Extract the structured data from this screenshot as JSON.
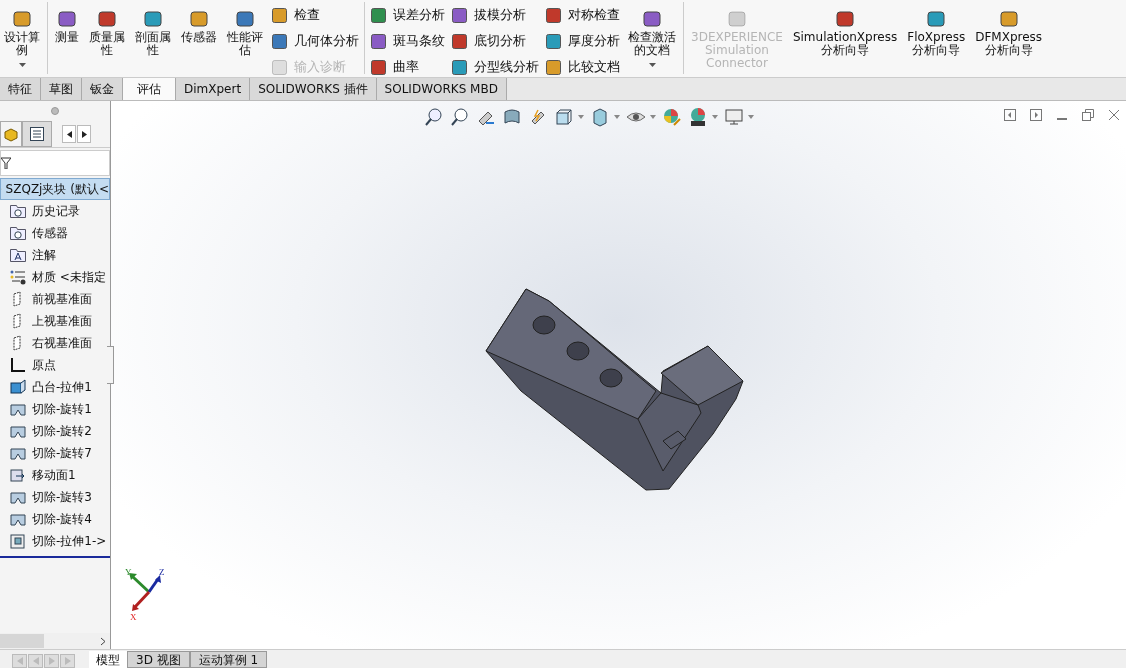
{
  "ribbon": {
    "groups": [
      {
        "sections": [
          {
            "kind": "large",
            "label": "设计算例",
            "menu": true,
            "disabled": false
          }
        ]
      },
      {
        "sections": [
          {
            "kind": "large",
            "label": "测量",
            "menu": false,
            "disabled": false
          },
          {
            "kind": "large",
            "label": "质量属性",
            "menu": false,
            "disabled": false
          },
          {
            "kind": "large",
            "label": "剖面属性",
            "menu": false,
            "disabled": false
          },
          {
            "kind": "large",
            "label": "传感器",
            "menu": false,
            "disabled": false
          },
          {
            "kind": "large",
            "label": "性能评估",
            "menu": false,
            "disabled": false
          },
          {
            "kind": "stack",
            "items": [
              {
                "label": "检查",
                "disabled": false
              },
              {
                "label": "几何体分析",
                "disabled": false
              },
              {
                "label": "输入诊断",
                "disabled": true
              }
            ]
          }
        ]
      },
      {
        "sections": [
          {
            "kind": "stack",
            "items": [
              {
                "label": "误差分析",
                "disabled": false
              },
              {
                "label": "斑马条纹",
                "disabled": false
              },
              {
                "label": "曲率",
                "disabled": false
              }
            ]
          },
          {
            "kind": "stack",
            "items": [
              {
                "label": "拔模分析",
                "disabled": false
              },
              {
                "label": "底切分析",
                "disabled": false
              },
              {
                "label": "分型线分析",
                "disabled": false
              }
            ]
          },
          {
            "kind": "stack",
            "items": [
              {
                "label": "对称检查",
                "disabled": false
              },
              {
                "label": "厚度分析",
                "disabled": false
              },
              {
                "label": "比较文档",
                "disabled": false
              }
            ]
          },
          {
            "kind": "large",
            "label": "检查激活的文档",
            "menu": true,
            "disabled": false
          }
        ]
      },
      {
        "sections": [
          {
            "kind": "large",
            "label": "3DEXPERIENCE Simulation Connector",
            "menu": false,
            "disabled": true
          },
          {
            "kind": "large",
            "label": "SimulationXpress 分析向导",
            "menu": false,
            "disabled": false
          },
          {
            "kind": "large",
            "label": "FloXpress 分析向导",
            "menu": false,
            "disabled": false
          },
          {
            "kind": "large",
            "label": "DFMXpress 分析向导",
            "menu": false,
            "disabled": false
          }
        ]
      }
    ]
  },
  "tabs": [
    {
      "label": "特征",
      "selected": false
    },
    {
      "label": "草图",
      "selected": false
    },
    {
      "label": "钣金",
      "selected": false
    },
    {
      "label": "评估",
      "selected": true
    },
    {
      "label": "DimXpert",
      "selected": false
    },
    {
      "label": "SOLIDWORKS 插件",
      "selected": false
    },
    {
      "label": "SOLIDWORKS MBD",
      "selected": false
    }
  ],
  "feature_tree": {
    "root": {
      "label": "SZQZj夹块  (默认<",
      "selected": true,
      "children": [
        {
          "label": "历史记录",
          "kind": "folder"
        },
        {
          "label": "传感器",
          "kind": "folder"
        },
        {
          "label": "注解",
          "kind": "annotation"
        },
        {
          "label": "材质 <未指定",
          "kind": "material"
        },
        {
          "label": "前视基准面",
          "kind": "plane"
        },
        {
          "label": "上视基准面",
          "kind": "plane"
        },
        {
          "label": "右视基准面",
          "kind": "plane"
        },
        {
          "label": "原点",
          "kind": "origin"
        },
        {
          "label": "凸台-拉伸1",
          "kind": "extrude"
        },
        {
          "label": "切除-旋转1",
          "kind": "revolve"
        },
        {
          "label": "切除-旋转2",
          "kind": "revolve"
        },
        {
          "label": "切除-旋转7",
          "kind": "revolve"
        },
        {
          "label": "移动面1",
          "kind": "move"
        },
        {
          "label": "切除-旋转3",
          "kind": "revolve"
        },
        {
          "label": "切除-旋转4",
          "kind": "revolve"
        },
        {
          "label": "切除-拉伸1->",
          "kind": "cut"
        }
      ]
    }
  },
  "triad": {
    "x": "X",
    "y": "Y",
    "z": "Z"
  },
  "model_tabs": [
    {
      "label": "模型",
      "selected": true
    },
    {
      "label": "3D 视图",
      "selected": false
    },
    {
      "label": "运动算例 1",
      "selected": false
    }
  ]
}
